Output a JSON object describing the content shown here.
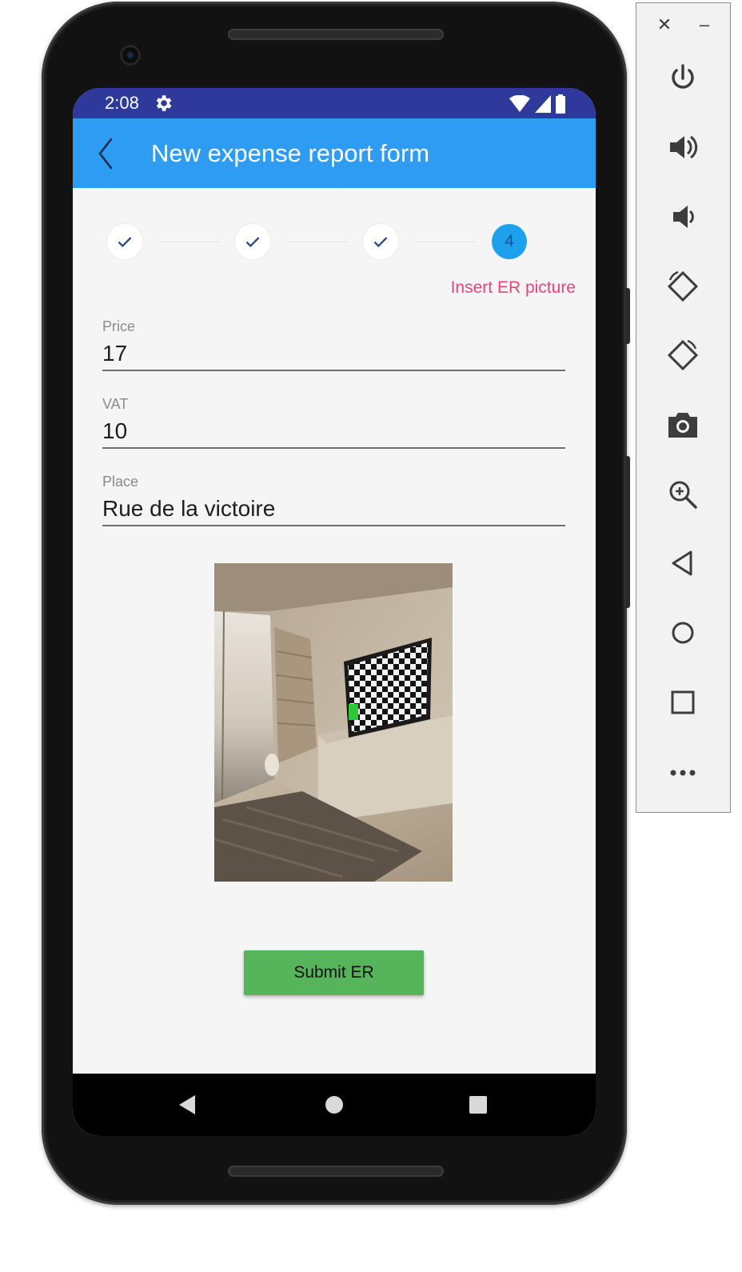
{
  "status_bar": {
    "time": "2:08",
    "icons": [
      "gear-icon",
      "wifi-icon",
      "signal-icon",
      "battery-icon"
    ]
  },
  "app_bar": {
    "title": "New expense report form",
    "back_icon": "chevron-left-icon"
  },
  "stepper": {
    "steps": [
      {
        "state": "completed",
        "icon": "check-icon"
      },
      {
        "state": "completed",
        "icon": "check-icon"
      },
      {
        "state": "completed",
        "icon": "check-icon"
      },
      {
        "state": "active",
        "number": "4"
      }
    ],
    "active_label": "Insert ER picture"
  },
  "form": {
    "price": {
      "label": "Price",
      "value": "17"
    },
    "vat": {
      "label": "VAT",
      "value": "10"
    },
    "place": {
      "label": "Place",
      "value": "Rue de la victoire"
    }
  },
  "submit_label": "Submit ER",
  "nav_bar": {
    "buttons": [
      "back-triangle-icon",
      "home-circle-icon",
      "recents-square-icon"
    ]
  },
  "emulator_panel": {
    "close_glyph": "✕",
    "minimize_glyph": "–",
    "buttons": [
      "power-icon",
      "volume-up-icon",
      "volume-down-icon",
      "rotate-left-icon",
      "rotate-right-icon",
      "camera-icon",
      "zoom-icon",
      "back-icon",
      "home-icon",
      "overview-icon",
      "more-icon"
    ]
  },
  "colors": {
    "status_bar": "#2d3a9b",
    "app_bar": "#2e9cf3",
    "step_active": "#1ea1ec",
    "step_label": "#e8437b",
    "submit_button": "#56b45a",
    "background": "#f5f5f5"
  }
}
